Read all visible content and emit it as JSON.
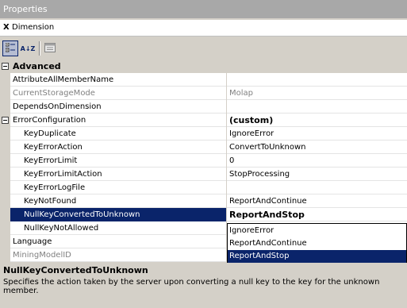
{
  "window": {
    "title": "Properties"
  },
  "object_bar": {
    "close_glyph": "X",
    "name": "Dimension"
  },
  "toolbar": {
    "buttons": [
      {
        "name": "categorized",
        "icon": "categorized-icon"
      },
      {
        "name": "alphabetical",
        "icon": "alphabetical-icon",
        "glyph": "A↓Z"
      },
      {
        "name": "property-pages",
        "icon": "property-pages-icon"
      }
    ]
  },
  "grid": {
    "category": {
      "label": "Advanced"
    },
    "rows": [
      {
        "name": "AttributeAllMemberName",
        "value": ""
      },
      {
        "name": "CurrentStorageMode",
        "value": "Molap"
      },
      {
        "name": "DependsOnDimension",
        "value": ""
      },
      {
        "name": "ErrorConfiguration",
        "value": "(custom)"
      },
      {
        "name": "KeyDuplicate",
        "value": "IgnoreError"
      },
      {
        "name": "KeyErrorAction",
        "value": "ConvertToUnknown"
      },
      {
        "name": "KeyErrorLimit",
        "value": "0"
      },
      {
        "name": "KeyErrorLimitAction",
        "value": "StopProcessing"
      },
      {
        "name": "KeyErrorLogFile",
        "value": ""
      },
      {
        "name": "KeyNotFound",
        "value": "ReportAndContinue"
      },
      {
        "name": "NullKeyConvertedToUnknown",
        "value": "ReportAndStop"
      },
      {
        "name": "NullKeyNotAllowed",
        "value": ""
      },
      {
        "name": "Language",
        "value": ""
      },
      {
        "name": "MiningModelID",
        "value": ""
      }
    ]
  },
  "dropdown": {
    "options": [
      "IgnoreError",
      "ReportAndContinue",
      "ReportAndStop"
    ],
    "selected": "ReportAndStop"
  },
  "description": {
    "title": "NullKeyConvertedToUnknown",
    "text": "Specifies the action taken by the server upon converting a null key to the key for the unknown member."
  }
}
